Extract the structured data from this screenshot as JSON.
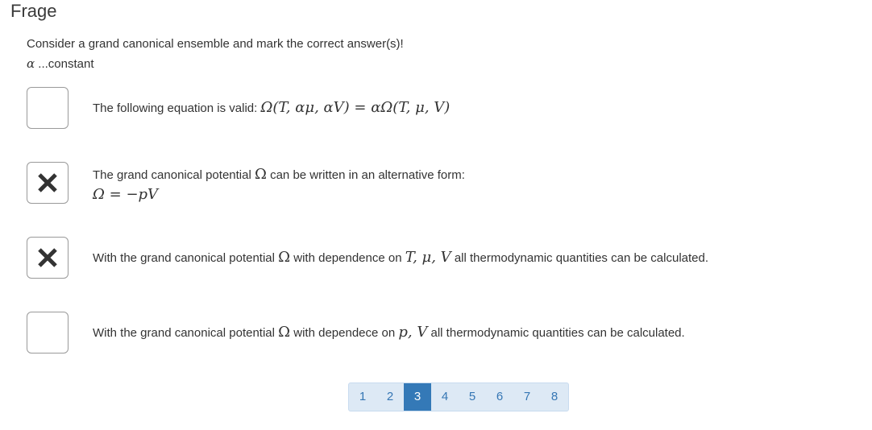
{
  "header": {
    "title": "Frage"
  },
  "question": {
    "prompt": "Consider a grand canonical ensemble and mark the correct answer(s)!",
    "alpha_symbol": "α",
    "alpha_note": " ...constant"
  },
  "options": [
    {
      "checked": false,
      "text": "The following equation is valid: ",
      "math": "Ω(T, αμ, αV) = αΩ(T, μ, V)"
    },
    {
      "checked": true,
      "text_a": "The grand canonical potential ",
      "omega": "Ω",
      "text_b": " can be written in an alternative form:",
      "math": "Ω = −pV"
    },
    {
      "checked": true,
      "text_a": "With the grand canonical potential ",
      "omega": "Ω",
      "text_b": " with dependence on ",
      "vars": "T, μ, V",
      "text_c": " all thermodynamic quantities can be calculated."
    },
    {
      "checked": false,
      "text_a": "With the grand canonical potential ",
      "omega": "Ω",
      "text_b": " with dependece on ",
      "vars": "p, V",
      "text_c": " all thermodynamic quantities can be calculated."
    }
  ],
  "pagination": {
    "pages": [
      "1",
      "2",
      "3",
      "4",
      "5",
      "6",
      "7",
      "8"
    ],
    "active": "3"
  },
  "colors": {
    "accent": "#3479b7",
    "pager_bg": "#dde9f5",
    "checkbox_border": "#9a9a9a"
  }
}
